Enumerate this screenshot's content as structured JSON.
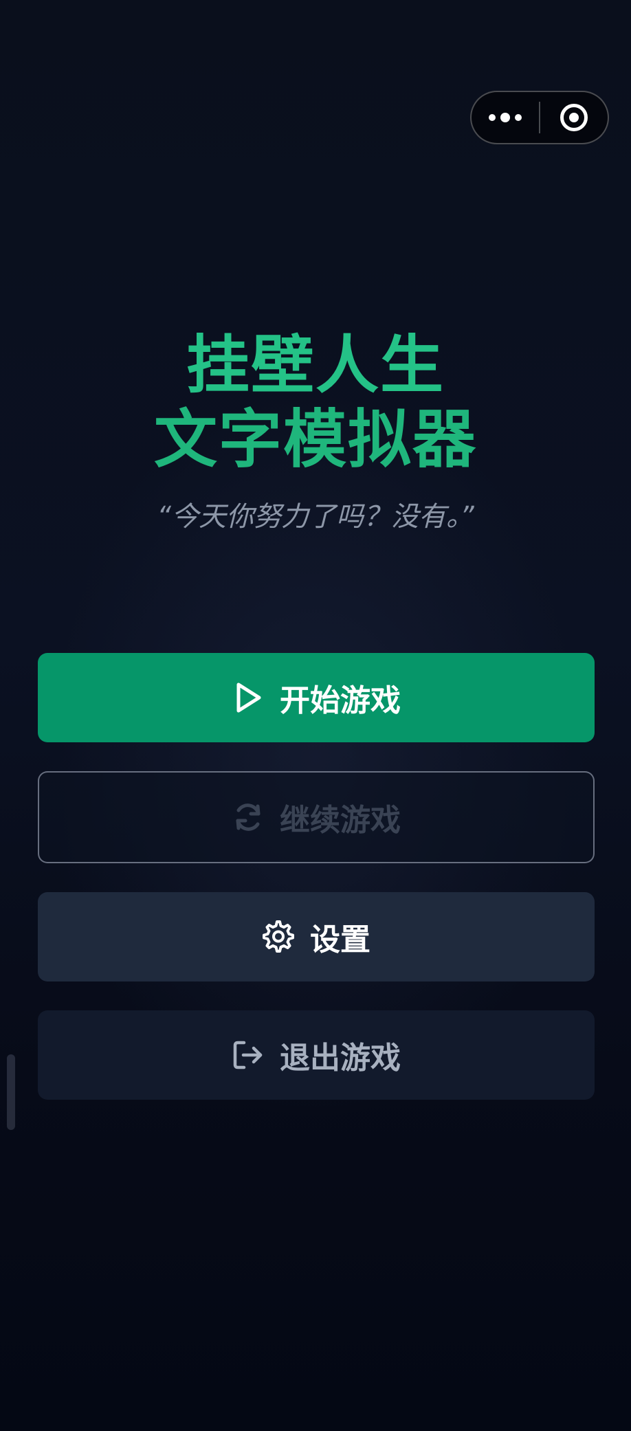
{
  "capsule": {
    "more_icon": "more-dots-icon",
    "close_icon": "target-circle-icon"
  },
  "title": {
    "line1": "挂壁人生",
    "line2": "文字模拟器"
  },
  "tagline": "“今天你努力了吗？没有。”",
  "menu": {
    "start": {
      "label": "开始游戏",
      "icon": "play-icon",
      "enabled": true
    },
    "continue": {
      "label": "继续游戏",
      "icon": "refresh-icon",
      "enabled": false
    },
    "settings": {
      "label": "设置",
      "icon": "gear-icon",
      "enabled": true
    },
    "exit": {
      "label": "退出游戏",
      "icon": "logout-icon",
      "enabled": true
    }
  },
  "colors": {
    "accent": "#069669",
    "title": "#22c083",
    "background": "#0a0f1c"
  }
}
